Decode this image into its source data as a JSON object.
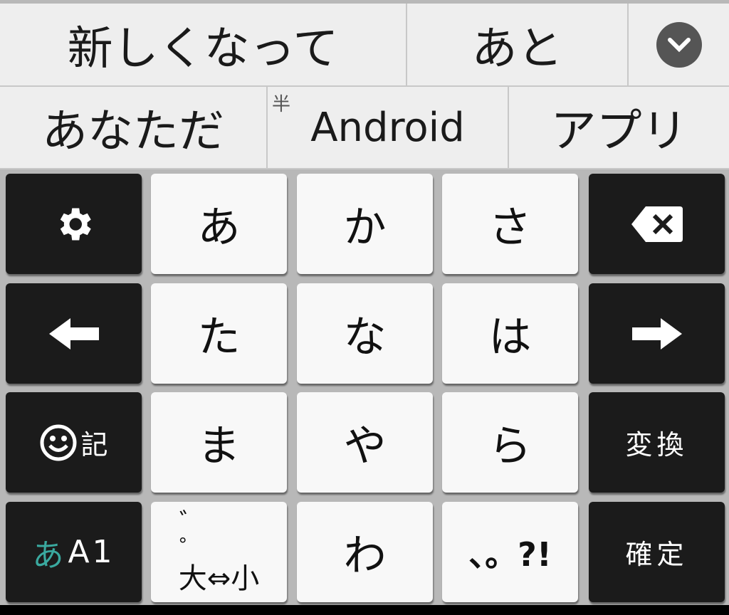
{
  "candidates_row1": [
    "新しくなって",
    "あと"
  ],
  "candidates_row2": [
    {
      "label": "あなただ"
    },
    {
      "label": "Android",
      "badge": "半"
    },
    {
      "label": "アプリ"
    }
  ],
  "more_icon": "chevron-down-icon",
  "keys": {
    "settings_icon": "gear-icon",
    "kana": [
      [
        "あ",
        "か",
        "さ"
      ],
      [
        "た",
        "な",
        "は"
      ],
      [
        "ま",
        "や",
        "ら"
      ]
    ],
    "backspace_icon": "backspace-icon",
    "left_icon": "arrow-left-icon",
    "right_icon": "arrow-right-icon",
    "emoji_label": "記",
    "convert_label": "変換",
    "mode_kana": "あ",
    "mode_alnum": "A1",
    "dakuten_top": "゛ ゜",
    "dakuten_bottom": "大⇔小",
    "wa": "わ",
    "punct": "、。?!",
    "confirm_label": "確定"
  },
  "colors": {
    "accent": "#3aa99f",
    "dark_key": "#1b1b1b",
    "light_key": "#f8f8f8"
  }
}
